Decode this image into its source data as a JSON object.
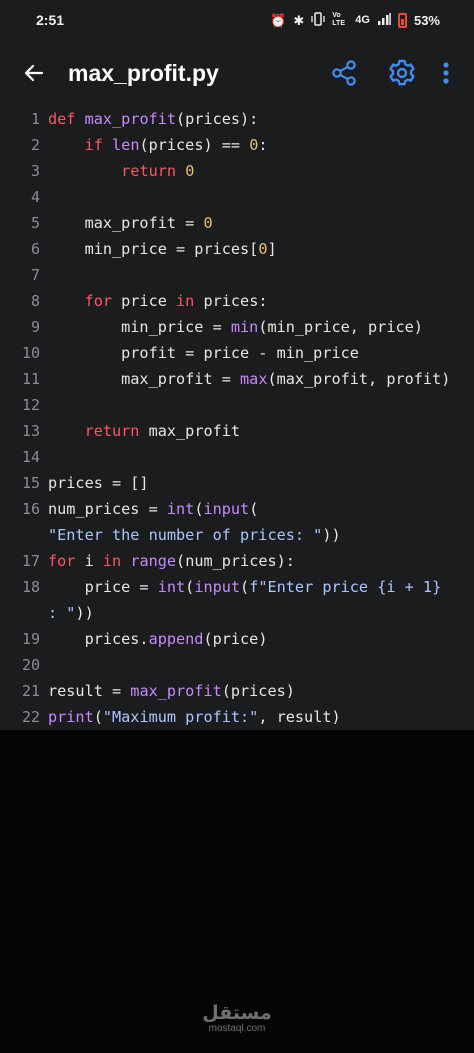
{
  "status_bar": {
    "time": "2:51",
    "alarm_icon": "⏰",
    "bluetooth_icon": "✱",
    "vibrate_icon": "📳",
    "volte_label": "Vo LTE",
    "network_label": "4G",
    "signal_icon": "▂▄▆",
    "battery_percent": "53%"
  },
  "app_bar": {
    "title": "max_profit.py",
    "accent_color": "#3d8df5"
  },
  "editor": {
    "lines": [
      {
        "number": "1",
        "tokens": [
          {
            "t": "def",
            "c": "kw"
          },
          {
            "t": " "
          },
          {
            "t": "max_profit",
            "c": "fn"
          },
          {
            "t": "(prices):"
          }
        ]
      },
      {
        "number": "2",
        "tokens": [
          {
            "t": "    "
          },
          {
            "t": "if",
            "c": "kw"
          },
          {
            "t": " "
          },
          {
            "t": "len",
            "c": "fn"
          },
          {
            "t": "(prices) == "
          },
          {
            "t": "0",
            "c": "num"
          },
          {
            "t": ":"
          }
        ]
      },
      {
        "number": "3",
        "tokens": [
          {
            "t": "        "
          },
          {
            "t": "return",
            "c": "kw"
          },
          {
            "t": " "
          },
          {
            "t": "0",
            "c": "num"
          }
        ]
      },
      {
        "number": "4",
        "tokens": []
      },
      {
        "number": "5",
        "tokens": [
          {
            "t": "    max_profit = "
          },
          {
            "t": "0",
            "c": "num"
          }
        ]
      },
      {
        "number": "6",
        "tokens": [
          {
            "t": "    min_price = prices["
          },
          {
            "t": "0",
            "c": "num"
          },
          {
            "t": "]"
          }
        ]
      },
      {
        "number": "7",
        "tokens": []
      },
      {
        "number": "8",
        "tokens": [
          {
            "t": "    "
          },
          {
            "t": "for",
            "c": "kw"
          },
          {
            "t": " price "
          },
          {
            "t": "in",
            "c": "kw"
          },
          {
            "t": " prices:"
          }
        ]
      },
      {
        "number": "9",
        "tokens": [
          {
            "t": "        min_price = "
          },
          {
            "t": "min",
            "c": "fn"
          },
          {
            "t": "(min_price, price)"
          }
        ]
      },
      {
        "number": "10",
        "tokens": [
          {
            "t": "        profit = price - min_price"
          }
        ]
      },
      {
        "number": "11",
        "tokens": [
          {
            "t": "        max_profit = "
          },
          {
            "t": "max",
            "c": "fn"
          },
          {
            "t": "(max_profit, profit)"
          }
        ]
      },
      {
        "number": "12",
        "tokens": []
      },
      {
        "number": "13",
        "tokens": [
          {
            "t": "    "
          },
          {
            "t": "return",
            "c": "kw"
          },
          {
            "t": " max_profit"
          }
        ]
      },
      {
        "number": "14",
        "tokens": []
      },
      {
        "number": "15",
        "tokens": [
          {
            "t": "prices = []"
          }
        ]
      },
      {
        "number": "16",
        "tokens": [
          {
            "t": "num_prices = "
          },
          {
            "t": "int",
            "c": "fn"
          },
          {
            "t": "("
          },
          {
            "t": "input",
            "c": "fn"
          },
          {
            "t": "("
          }
        ]
      },
      {
        "number": "",
        "tokens": [
          {
            "t": "\"Enter the number of prices: \"",
            "c": "str"
          },
          {
            "t": "))"
          }
        ]
      },
      {
        "number": "17",
        "tokens": [
          {
            "t": "for",
            "c": "kw"
          },
          {
            "t": " i "
          },
          {
            "t": "in",
            "c": "kw"
          },
          {
            "t": " "
          },
          {
            "t": "range",
            "c": "fn"
          },
          {
            "t": "(num_prices):"
          }
        ]
      },
      {
        "number": "18",
        "tokens": [
          {
            "t": "    price = "
          },
          {
            "t": "int",
            "c": "fn"
          },
          {
            "t": "("
          },
          {
            "t": "input",
            "c": "fn"
          },
          {
            "t": "("
          },
          {
            "t": "f\"Enter price {i + 1}",
            "c": "str"
          }
        ]
      },
      {
        "number": "",
        "tokens": [
          {
            "t": ": \"",
            "c": "str"
          },
          {
            "t": "))"
          }
        ]
      },
      {
        "number": "19",
        "tokens": [
          {
            "t": "    prices."
          },
          {
            "t": "append",
            "c": "fn"
          },
          {
            "t": "(price)"
          }
        ]
      },
      {
        "number": "20",
        "tokens": []
      },
      {
        "number": "21",
        "tokens": [
          {
            "t": "result = "
          },
          {
            "t": "max_profit",
            "c": "fn"
          },
          {
            "t": "(prices)"
          }
        ]
      },
      {
        "number": "22",
        "tokens": [
          {
            "t": "print",
            "c": "fn"
          },
          {
            "t": "("
          },
          {
            "t": "\"Maximum profit:\"",
            "c": "str"
          },
          {
            "t": ", result)"
          }
        ]
      }
    ]
  },
  "watermark": {
    "main": "مستقل",
    "sub": "mostaql.com"
  }
}
